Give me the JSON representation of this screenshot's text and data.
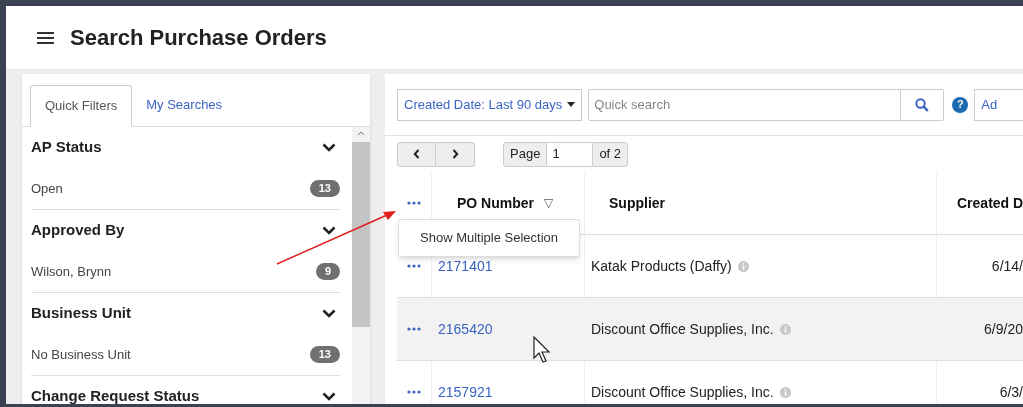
{
  "title": "Search Purchase Orders",
  "filter_tabs": [
    {
      "label": "Quick Filters",
      "selected": true
    },
    {
      "label": "My Searches",
      "selected": false
    }
  ],
  "filter_groups": [
    {
      "title": "AP Status",
      "options": [
        {
          "label": "Open",
          "count": "13"
        }
      ]
    },
    {
      "title": "Approved By",
      "options": [
        {
          "label": "Wilson, Brynn",
          "count": "9"
        }
      ]
    },
    {
      "title": "Business Unit",
      "options": [
        {
          "label": "No Business Unit",
          "count": "13"
        }
      ]
    },
    {
      "title": "Change Request Status"
    }
  ],
  "toolbar": {
    "date_filter": "Created Date: Last 90 days",
    "search": {
      "placeholder": "Quick search"
    },
    "help": "?",
    "add_button": "Ad"
  },
  "pager": {
    "page_label": "Page",
    "page_value": "1",
    "of_label": "of 2"
  },
  "table": {
    "columns": [
      {
        "label": "PO Number",
        "sort_icon": "▽"
      },
      {
        "label": "Supplier"
      },
      {
        "label": "Created D"
      }
    ],
    "rows": [
      {
        "po_number": "2171401",
        "supplier": "Katak Products (Daffy)",
        "created": "6/14/",
        "hovered": false
      },
      {
        "po_number": "2165420",
        "supplier": "Discount Office Supplies, Inc.",
        "created": "6/9/20",
        "hovered": true
      },
      {
        "po_number": "2157921",
        "supplier": "Discount Office Supplies, Inc.",
        "created": "6/3/",
        "hovered": false
      }
    ]
  },
  "row_menu": {
    "items": [
      "Show Multiple Selection"
    ]
  }
}
